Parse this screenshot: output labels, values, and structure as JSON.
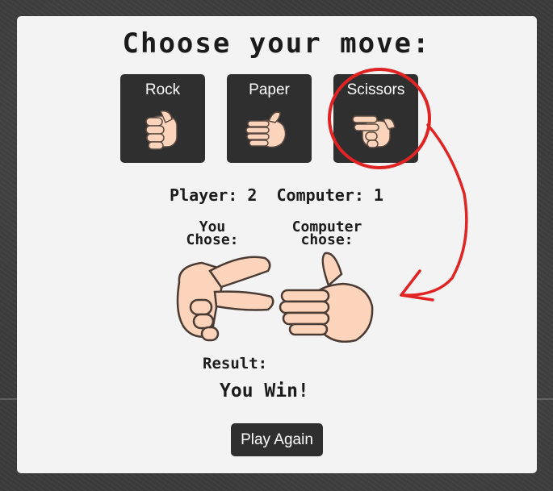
{
  "game": {
    "title": "Choose your move:",
    "moves": [
      {
        "label": "Rock",
        "icon": "rock-hand-icon"
      },
      {
        "label": "Paper",
        "icon": "paper-hand-icon"
      },
      {
        "label": "Scissors",
        "icon": "scissors-hand-icon"
      }
    ],
    "score_text": "Player: 2  Computer: 1",
    "player_label_line1": "You",
    "player_label_line2": "Chose:",
    "computer_label_line1": "Computer",
    "computer_label_line2": "chose:",
    "player_choice_icon": "scissors-hand-icon",
    "computer_choice_icon": "paper-hand-icon",
    "result_label": "Result:",
    "result_value": "You Win!",
    "play_again_label": "Play Again"
  },
  "colors": {
    "background": "#3b3b3b",
    "card": "#f3f3f3",
    "button": "#2f2f2f",
    "skin": "#fbd4bb",
    "annotation_red": "#e02424"
  }
}
